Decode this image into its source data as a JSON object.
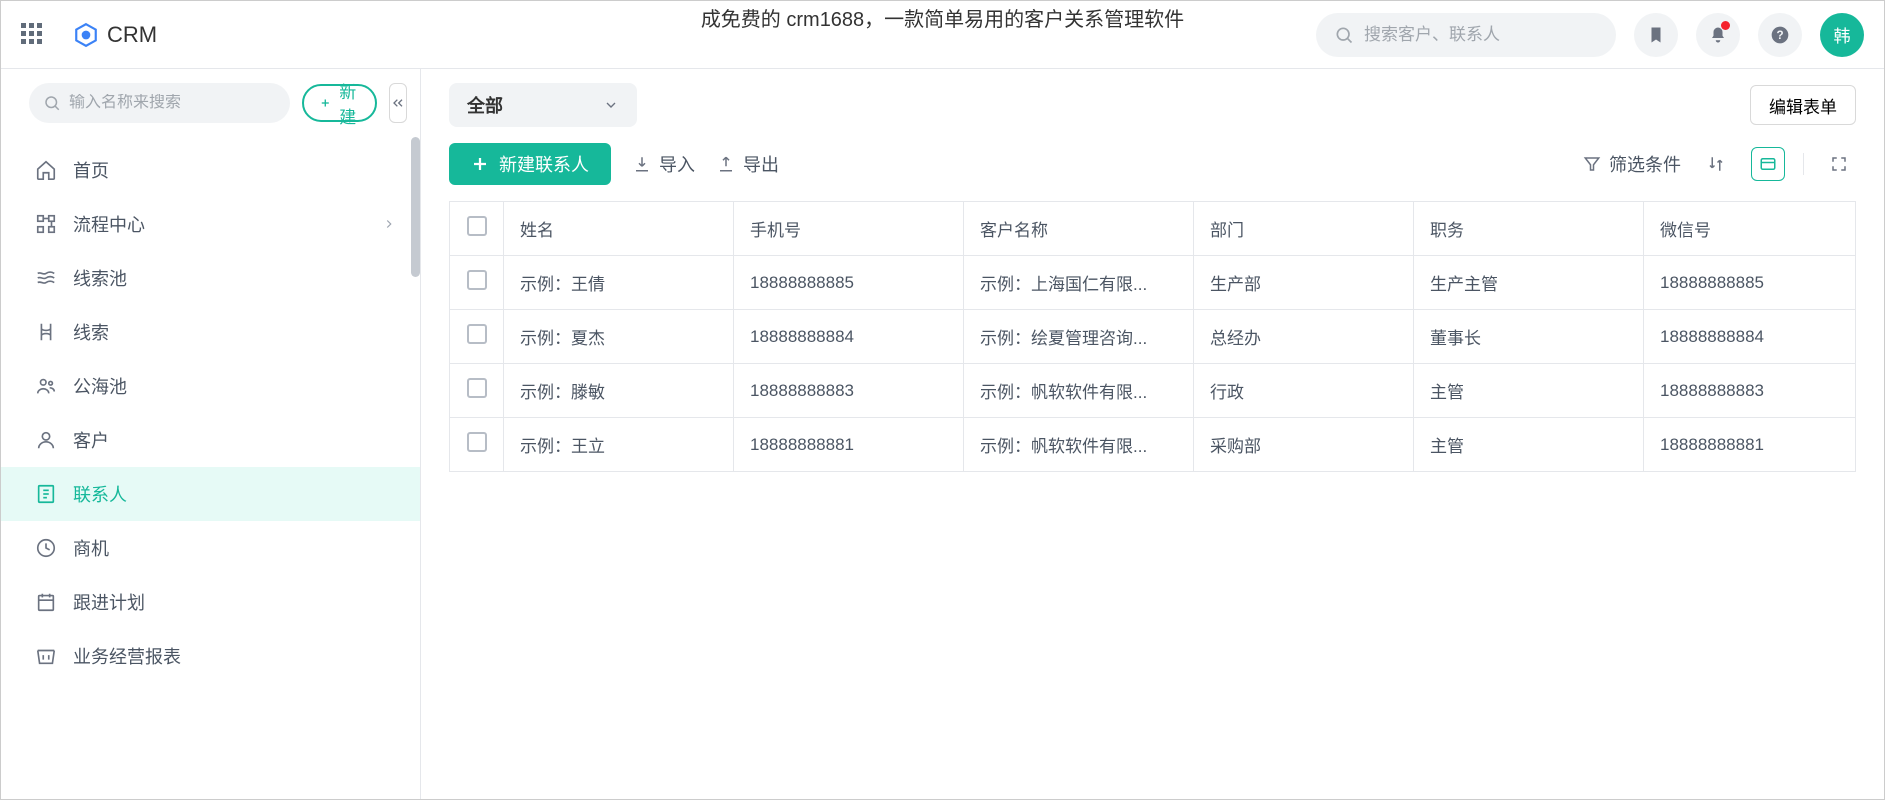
{
  "page_caption": "成免费的 crm1688，一款简单易用的客户关系管理软件",
  "brand": "CRM",
  "global_search_placeholder": "搜索客户、联系人",
  "avatar_text": "韩",
  "sidebar_search_placeholder": "输入名称来搜索",
  "new_button_label": "新建",
  "nav": [
    {
      "label": "首页",
      "icon": "home"
    },
    {
      "label": "流程中心",
      "icon": "process",
      "chevron": true
    },
    {
      "label": "线索池",
      "icon": "pool"
    },
    {
      "label": "线索",
      "icon": "lead"
    },
    {
      "label": "公海池",
      "icon": "public"
    },
    {
      "label": "客户",
      "icon": "customer"
    },
    {
      "label": "联系人",
      "icon": "contact",
      "active": true
    },
    {
      "label": "商机",
      "icon": "opportunity"
    },
    {
      "label": "跟进计划",
      "icon": "plan"
    },
    {
      "label": "业务经营报表",
      "icon": "report"
    }
  ],
  "filter_label": "全部",
  "edit_form_label": "编辑表单",
  "new_contact_label": "新建联系人",
  "import_label": "导入",
  "export_label": "导出",
  "filter_conditions_label": "筛选条件",
  "columns": [
    "姓名",
    "手机号",
    "客户名称",
    "部门",
    "职务",
    "微信号"
  ],
  "rows": [
    {
      "name": "示例：王倩",
      "phone": "18888888885",
      "customer": "示例：上海国仁有限...",
      "dept": "生产部",
      "position": "生产主管",
      "wechat": "18888888885"
    },
    {
      "name": "示例：夏杰",
      "phone": "18888888884",
      "customer": "示例：绘夏管理咨询...",
      "dept": "总经办",
      "position": "董事长",
      "wechat": "18888888884"
    },
    {
      "name": "示例：滕敏",
      "phone": "18888888883",
      "customer": "示例：帆软软件有限...",
      "dept": "行政",
      "position": "主管",
      "wechat": "18888888883"
    },
    {
      "name": "示例：王立",
      "phone": "18888888881",
      "customer": "示例：帆软软件有限...",
      "dept": "采购部",
      "position": "主管",
      "wechat": "18888888881"
    }
  ]
}
